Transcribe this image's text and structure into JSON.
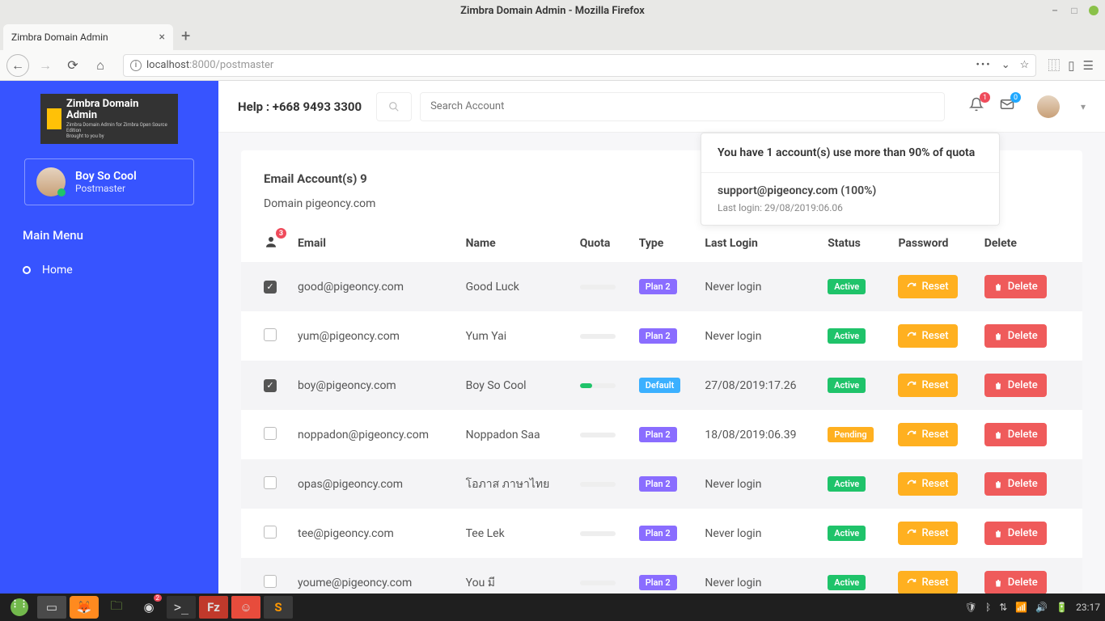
{
  "os": {
    "title": "Zimbra Domain Admin - Mozilla Firefox"
  },
  "browser": {
    "tab_title": "Zimbra Domain Admin",
    "url_host": "localhost",
    "url_port": ":8000",
    "url_path": "/postmaster"
  },
  "brand": {
    "title": "Zimbra Domain Admin",
    "sub1": "Zimbra Domain Admin for Zimbra Open Source Edition",
    "sub2": "Brought to you by"
  },
  "user": {
    "name": "Boy So Cool",
    "role": "Postmaster"
  },
  "menu": {
    "header": "Main Menu",
    "home": "Home"
  },
  "topbar": {
    "help": "Help : +668 9493 3300",
    "search_placeholder": "Search Account",
    "bell_badge": "1",
    "mail_badge": "0"
  },
  "popover": {
    "head": "You have 1 account(s) use more than 90% of quota",
    "email": "support@pigeoncy.com (100%)",
    "sub": "Last login: 29/08/2019:06.06"
  },
  "panel": {
    "title": "Email Account(s) 9",
    "domain": "Domain pigeoncy.com",
    "person_badge": "3"
  },
  "columns": {
    "email": "Email",
    "name": "Name",
    "quota": "Quota",
    "type": "Type",
    "last_login": "Last Login",
    "status": "Status",
    "password": "Password",
    "delete": "Delete"
  },
  "labels": {
    "reset": "Reset",
    "delete": "Delete",
    "active": "Active",
    "pending": "Pending",
    "plan2": "Plan 2",
    "default": "Default"
  },
  "rows": [
    {
      "checked": true,
      "email": "good@pigeoncy.com",
      "name": "Good Luck",
      "quota": 0,
      "type": "plan2",
      "last": "Never login",
      "status": "active"
    },
    {
      "checked": false,
      "email": "yum@pigeoncy.com",
      "name": "Yum Yai",
      "quota": 0,
      "type": "plan2",
      "last": "Never login",
      "status": "active"
    },
    {
      "checked": true,
      "email": "boy@pigeoncy.com",
      "name": "Boy So Cool",
      "quota": 35,
      "type": "default",
      "last": "27/08/2019:17.26",
      "status": "active"
    },
    {
      "checked": false,
      "email": "noppadon@pigeoncy.com",
      "name": "Noppadon Saa",
      "quota": 0,
      "type": "plan2",
      "last": "18/08/2019:06.39",
      "status": "pending"
    },
    {
      "checked": false,
      "email": "opas@pigeoncy.com",
      "name": "โอภาส ภาษาไทย",
      "quota": 0,
      "type": "plan2",
      "last": "Never login",
      "status": "active"
    },
    {
      "checked": false,
      "email": "tee@pigeoncy.com",
      "name": "Tee Lek",
      "quota": 0,
      "type": "plan2",
      "last": "Never login",
      "status": "active"
    },
    {
      "checked": false,
      "email": "youme@pigeoncy.com",
      "name": "You มี",
      "quota": 0,
      "type": "plan2",
      "last": "Never login",
      "status": "active"
    }
  ],
  "taskbar": {
    "time": "23:17"
  }
}
